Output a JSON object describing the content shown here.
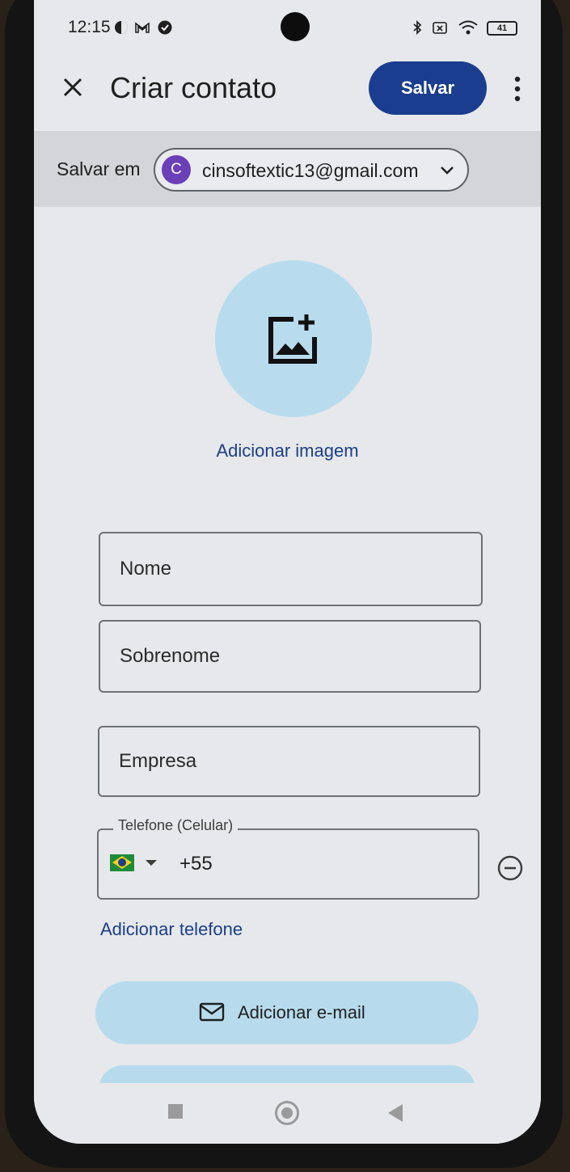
{
  "status_bar": {
    "time": "12:15",
    "battery": "41"
  },
  "header": {
    "title": "Criar contato",
    "save_label": "Salvar"
  },
  "save_in": {
    "label": "Salvar em",
    "account_initial": "C",
    "account_email": "cinsoftextic13@gmail.com"
  },
  "photo": {
    "add_image_label": "Adicionar imagem"
  },
  "fields": {
    "first_name_placeholder": "Nome",
    "last_name_placeholder": "Sobrenome",
    "company_placeholder": "Empresa",
    "phone_legend": "Telefone (Celular)",
    "phone_value": "+55"
  },
  "actions": {
    "add_phone_label": "Adicionar telefone",
    "add_email_label": "Adicionar e-mail"
  },
  "colors": {
    "accent": "#1a3d8f",
    "link": "#1b3f86",
    "photo_bg": "#b8dcee",
    "avatar": "#6b3fb8"
  }
}
